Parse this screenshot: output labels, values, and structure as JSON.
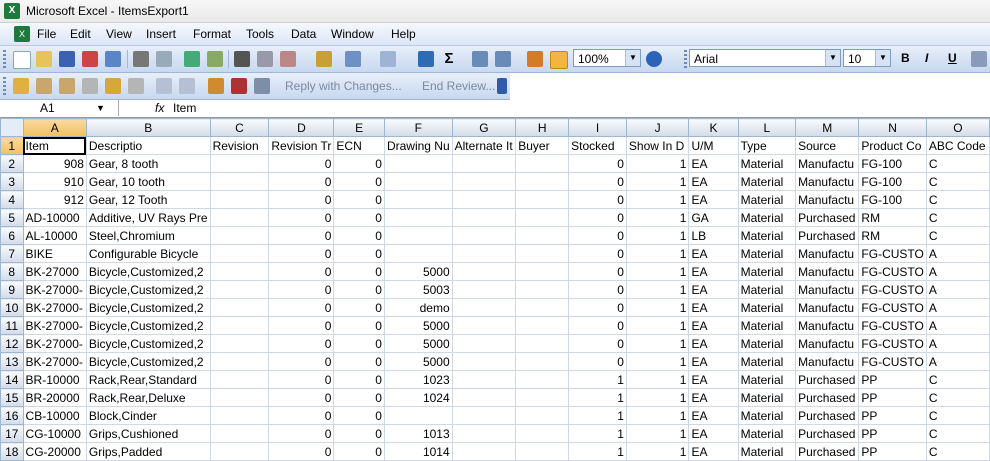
{
  "window": {
    "title": "Microsoft Excel - ItemsExport1"
  },
  "menu": [
    "File",
    "Edit",
    "View",
    "Insert",
    "Format",
    "Tools",
    "Data",
    "Window",
    "Help"
  ],
  "toolbar": {
    "zoom": "100%",
    "font": "Arial",
    "size": "10",
    "bold": "B",
    "italic": "I",
    "underline": "U"
  },
  "review": {
    "reply": "Reply with Changes...",
    "end": "End Review..."
  },
  "formula": {
    "cell": "A1",
    "fx": "fx",
    "value": "Item"
  },
  "columns": [
    "A",
    "B",
    "C",
    "D",
    "E",
    "F",
    "G",
    "H",
    "I",
    "J",
    "K",
    "L",
    "M",
    "N",
    "O"
  ],
  "rows": [
    [
      "Item",
      "Descriptio",
      "Revision",
      "Revision Tr",
      "ECN",
      "Drawing Nu",
      "Alternate It",
      "Buyer",
      "Stocked",
      "Show In D",
      "U/M",
      "Type",
      "Source",
      "Product Co",
      "ABC Code"
    ],
    [
      "908",
      "Gear, 8 tooth",
      "",
      "0",
      "0",
      "",
      "",
      "",
      "0",
      "1",
      "EA",
      "Material",
      "Manufactu",
      "FG-100",
      "C"
    ],
    [
      "910",
      "Gear, 10 tooth",
      "",
      "0",
      "0",
      "",
      "",
      "",
      "0",
      "1",
      "EA",
      "Material",
      "Manufactu",
      "FG-100",
      "C"
    ],
    [
      "912",
      "Gear, 12 Tooth",
      "",
      "0",
      "0",
      "",
      "",
      "",
      "0",
      "1",
      "EA",
      "Material",
      "Manufactu",
      "FG-100",
      "C"
    ],
    [
      "AD-10000",
      "Additive, UV Rays Pre",
      "",
      "0",
      "0",
      "",
      "",
      "",
      "0",
      "1",
      "GA",
      "Material",
      "Purchased",
      "RM",
      "C"
    ],
    [
      "AL-10000",
      "Steel,Chromium",
      "",
      "0",
      "0",
      "",
      "",
      "",
      "0",
      "1",
      "LB",
      "Material",
      "Purchased",
      "RM",
      "C"
    ],
    [
      "BIKE",
      "Configurable Bicycle",
      "",
      "0",
      "0",
      "",
      "",
      "",
      "0",
      "1",
      "EA",
      "Material",
      "Manufactu",
      "FG-CUSTO",
      "A"
    ],
    [
      "BK-27000",
      "Bicycle,Customized,2",
      "",
      "0",
      "0",
      "5000",
      "",
      "",
      "0",
      "1",
      "EA",
      "Material",
      "Manufactu",
      "FG-CUSTO",
      "A"
    ],
    [
      "BK-27000-",
      "Bicycle,Customized,2",
      "",
      "0",
      "0",
      "5003",
      "",
      "",
      "0",
      "1",
      "EA",
      "Material",
      "Manufactu",
      "FG-CUSTO",
      "A"
    ],
    [
      "BK-27000-",
      "Bicycle,Customized,2",
      "",
      "0",
      "0",
      "demo",
      "",
      "",
      "0",
      "1",
      "EA",
      "Material",
      "Manufactu",
      "FG-CUSTO",
      "A"
    ],
    [
      "BK-27000-",
      "Bicycle,Customized,2",
      "",
      "0",
      "0",
      "5000",
      "",
      "",
      "0",
      "1",
      "EA",
      "Material",
      "Manufactu",
      "FG-CUSTO",
      "A"
    ],
    [
      "BK-27000-",
      "Bicycle,Customized,2",
      "",
      "0",
      "0",
      "5000",
      "",
      "",
      "0",
      "1",
      "EA",
      "Material",
      "Manufactu",
      "FG-CUSTO",
      "A"
    ],
    [
      "BK-27000-",
      "Bicycle,Customized,2",
      "",
      "0",
      "0",
      "5000",
      "",
      "",
      "0",
      "1",
      "EA",
      "Material",
      "Manufactu",
      "FG-CUSTO",
      "A"
    ],
    [
      "BR-10000",
      "Rack,Rear,Standard",
      "",
      "0",
      "0",
      "1023",
      "",
      "",
      "1",
      "1",
      "EA",
      "Material",
      "Purchased",
      "PP",
      "C"
    ],
    [
      "BR-20000",
      "Rack,Rear,Deluxe",
      "",
      "0",
      "0",
      "1024",
      "",
      "",
      "1",
      "1",
      "EA",
      "Material",
      "Purchased",
      "PP",
      "C"
    ],
    [
      "CB-10000",
      "Block,Cinder",
      "",
      "0",
      "0",
      "",
      "",
      "",
      "1",
      "1",
      "EA",
      "Material",
      "Purchased",
      "PP",
      "C"
    ],
    [
      "CG-10000",
      "Grips,Cushioned",
      "",
      "0",
      "0",
      "1013",
      "",
      "",
      "1",
      "1",
      "EA",
      "Material",
      "Purchased",
      "PP",
      "C"
    ],
    [
      "CG-20000",
      "Grips,Padded",
      "",
      "0",
      "0",
      "1014",
      "",
      "",
      "1",
      "1",
      "EA",
      "Material",
      "Purchased",
      "PP",
      "C"
    ]
  ]
}
